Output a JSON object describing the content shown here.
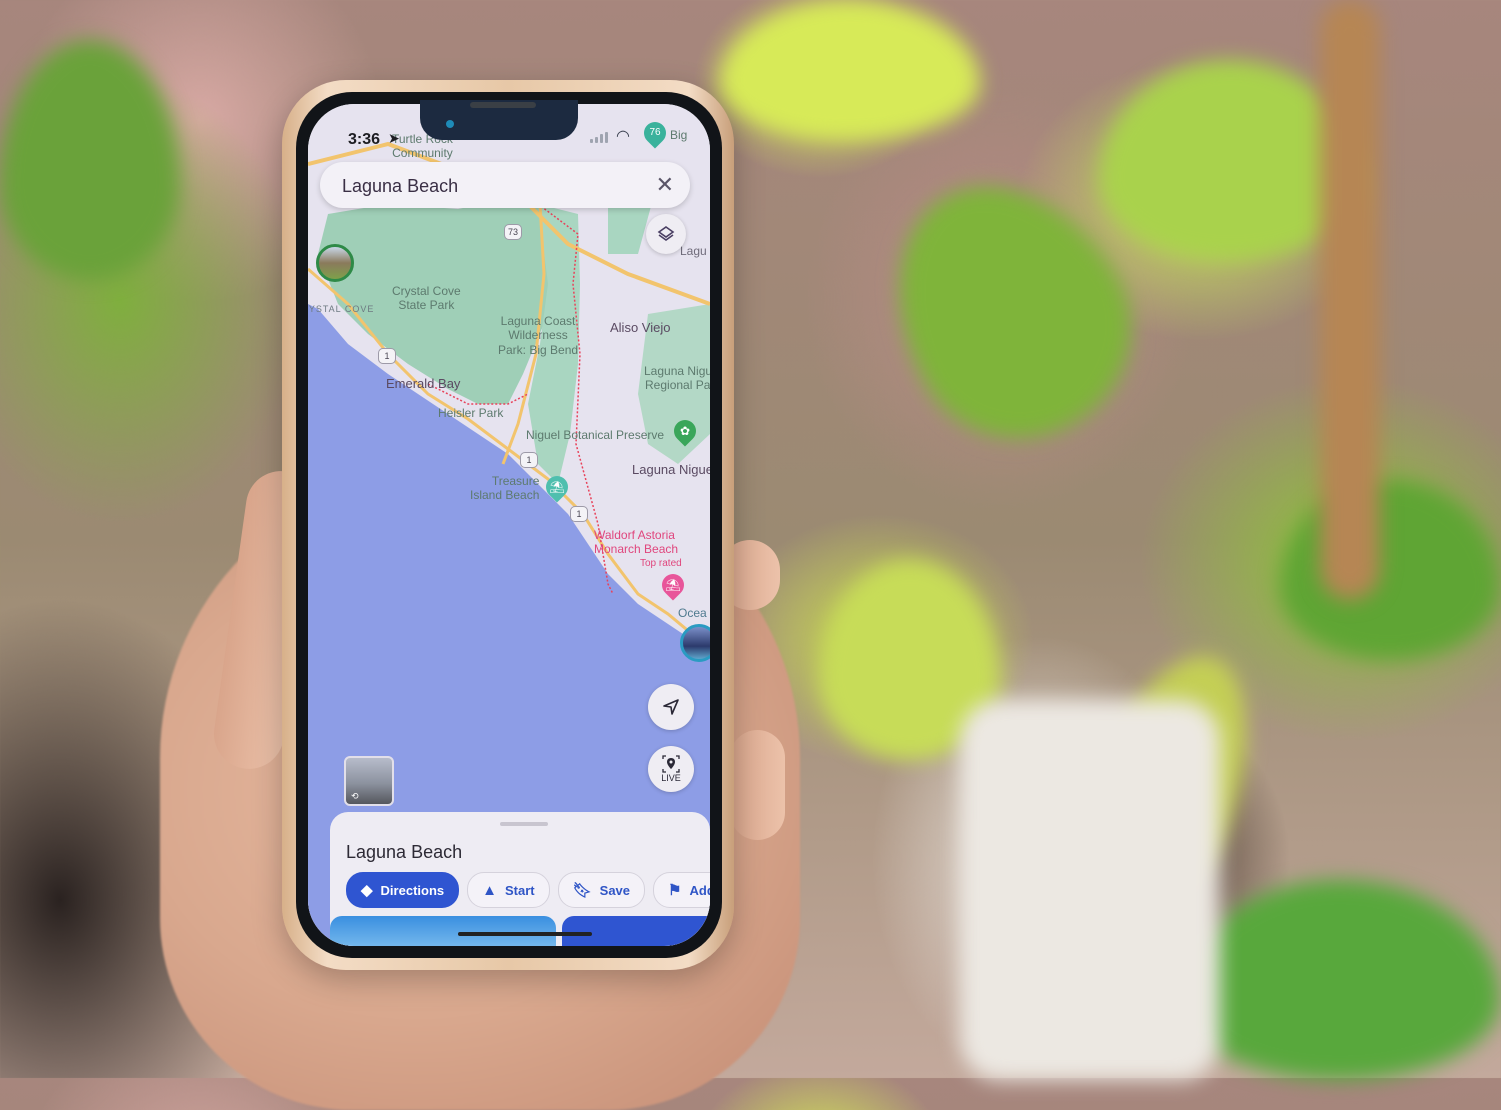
{
  "status_bar": {
    "time": "3:36",
    "temperature_badge": "76"
  },
  "search": {
    "value": "Laguna Beach",
    "clear_icon": "close-icon"
  },
  "map": {
    "labels": {
      "turtle_community": "Turtle Rock\nCommunity",
      "crystal_cove_area": "CRYSTAL COVE",
      "crystal_cove_park": "Crystal Cove\nState Park",
      "laguna_coast": "Laguna Coast\nWilderness\nPark: Big Bend",
      "aliso_viejo": "Aliso Viejo",
      "laguna_niguel_regional": "Laguna Niguel\nRegional Park",
      "emerald_bay": "Emerald Bay",
      "heisler_park": "Heisler Park",
      "niguel_botanical": "Niguel Botanical Preserve",
      "laguna_niguel": "Laguna Niguel",
      "treasure_island": "Treasure\nIsland Beach",
      "waldorf": "Waldorf Astoria\nMonarch Beach",
      "top_rated": "Top rated",
      "ocean": "Ocea",
      "big": "Big",
      "laguna_partial": "Lagu"
    },
    "route_shields": [
      "73",
      "1",
      "1",
      "1"
    ],
    "colors": {
      "water": "#8d9de6",
      "land": "#e6e3ef",
      "park": "#9fcfb7",
      "highway": "#f2c46d",
      "boundary": "#e8425a"
    }
  },
  "controls": {
    "layers_icon": "layers-icon",
    "locate_icon": "navigation-arrow-icon",
    "live_label": "LIVE"
  },
  "sheet": {
    "title": "Laguna Beach",
    "actions": [
      {
        "label": "Directions",
        "icon": "directions-icon"
      },
      {
        "label": "Start",
        "icon": "navigation-icon"
      },
      {
        "label": "Save",
        "icon": "bookmark-icon"
      },
      {
        "label": "Add",
        "icon": "flag-icon"
      }
    ]
  }
}
